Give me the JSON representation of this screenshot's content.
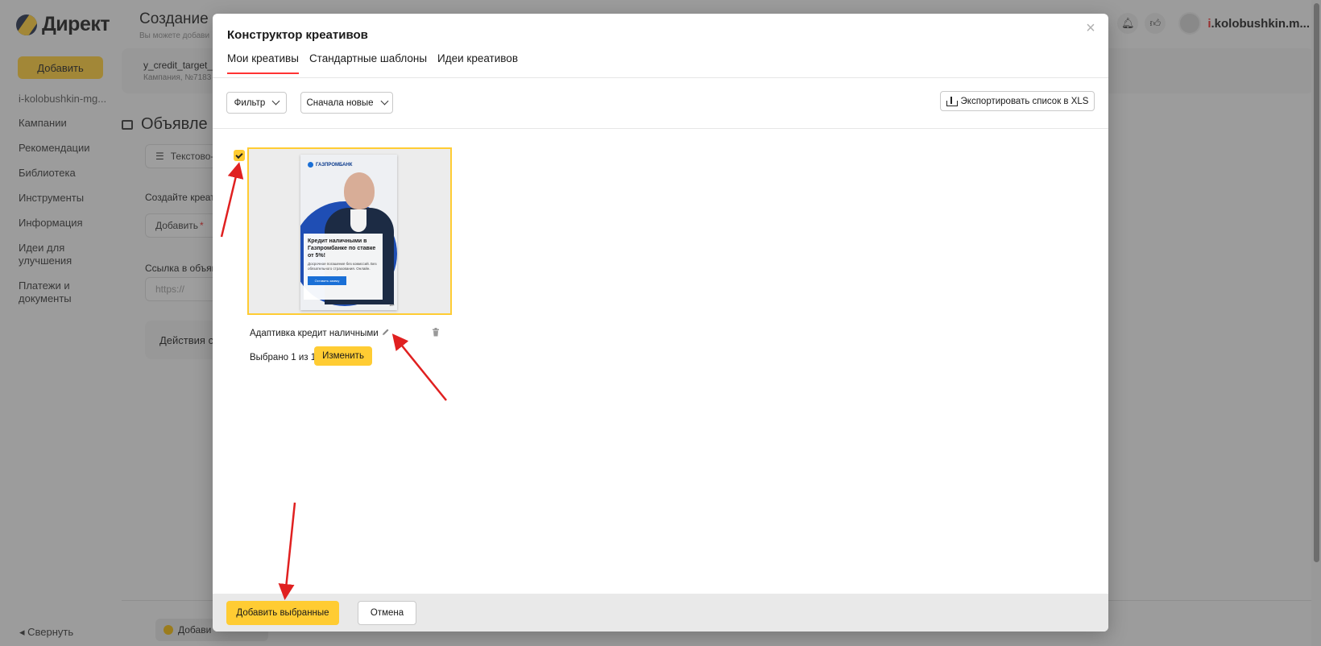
{
  "app": {
    "logo_text": "Директ",
    "add_button": "Добавить",
    "sidebar": {
      "account": "i-kolobushkin-mg...",
      "items": [
        "Кампании",
        "Рекомендации",
        "Библиотека",
        "Инструменты",
        "Информация",
        "Идеи для улучшения",
        "Платежи и документы"
      ],
      "collapse": "Свернуть"
    },
    "header": {
      "title": "Создание о",
      "subtitle": "Вы можете добави"
    },
    "user": {
      "name_first": "i",
      "name_rest": ".kolobushkin.m..."
    },
    "campaign": {
      "name": "y_credit_target_",
      "number": "Кампания, №7183"
    },
    "section_title": "Объявле",
    "ad_type": "Текстово-",
    "create_label": "Создайте креати",
    "add_select": "Добавить",
    "link_label": "Ссылка в объяв",
    "link_placeholder": "https://",
    "actions_box": "Действия с с",
    "bottom_pill": "Добави"
  },
  "modal": {
    "title": "Конструктор креативов",
    "tabs": [
      {
        "label": "Мои креативы",
        "active": true
      },
      {
        "label": "Стандартные шаблоны",
        "active": false
      },
      {
        "label": "Идеи креативов",
        "active": false
      }
    ],
    "filter_label": "Фильтр",
    "sort_label": "Сначала новые",
    "export_label": "Экспортировать список в XLS",
    "creative": {
      "selected": true,
      "name": "Адаптивка кредит наличными",
      "ad": {
        "bank": "ГАЗПРОМБАНК",
        "title": "Кредит наличными в Газпромбанке по ставке от 5%!",
        "text": "Досрочное погашение без комиссий. Без обязательного страхования. Онлайн.",
        "button": "Оставить заявку",
        "age": "18+"
      }
    },
    "selected_text": "Выбрано 1 из 1",
    "change_button": "Изменить",
    "footer": {
      "add_selected": "Добавить выбранные",
      "cancel": "Отмена"
    }
  },
  "colors": {
    "accent": "#ffcc33",
    "tab_underline": "#ff3333",
    "arrow": "#e02020"
  }
}
